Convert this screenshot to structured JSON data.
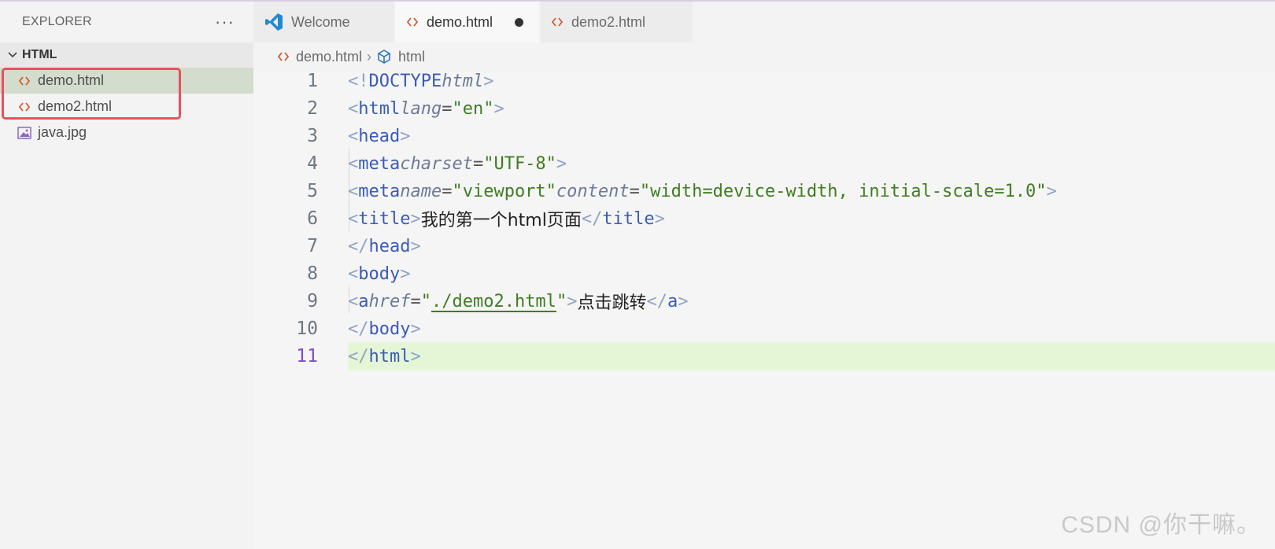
{
  "sidebar": {
    "title": "EXPLORER",
    "more_label": "···",
    "folder": "HTML",
    "files": [
      {
        "name": "demo.html",
        "icon": "html-file-icon"
      },
      {
        "name": "demo2.html",
        "icon": "html-file-icon"
      },
      {
        "name": "java.jpg",
        "icon": "image-file-icon"
      }
    ]
  },
  "tabs": [
    {
      "label": "Welcome",
      "icon": "vscode-logo-icon"
    },
    {
      "label": "demo.html",
      "icon": "html-file-icon",
      "active": true,
      "modified": true
    },
    {
      "label": "demo2.html",
      "icon": "html-file-icon"
    }
  ],
  "breadcrumb": {
    "file": "demo.html",
    "symbol": "html"
  },
  "editor": {
    "current_line": 11,
    "line_numbers": [
      "1",
      "2",
      "3",
      "4",
      "5",
      "6",
      "7",
      "8",
      "9",
      "10",
      "11"
    ]
  },
  "watermark": "CSDN @你干嘛。",
  "colors": {
    "accent_highlight": "#e8515d",
    "current_line_bg": "#e4f6d6",
    "active_file_bg": "#d4dccd",
    "tag": "#3a5bb7",
    "string": "#3f7d20"
  }
}
